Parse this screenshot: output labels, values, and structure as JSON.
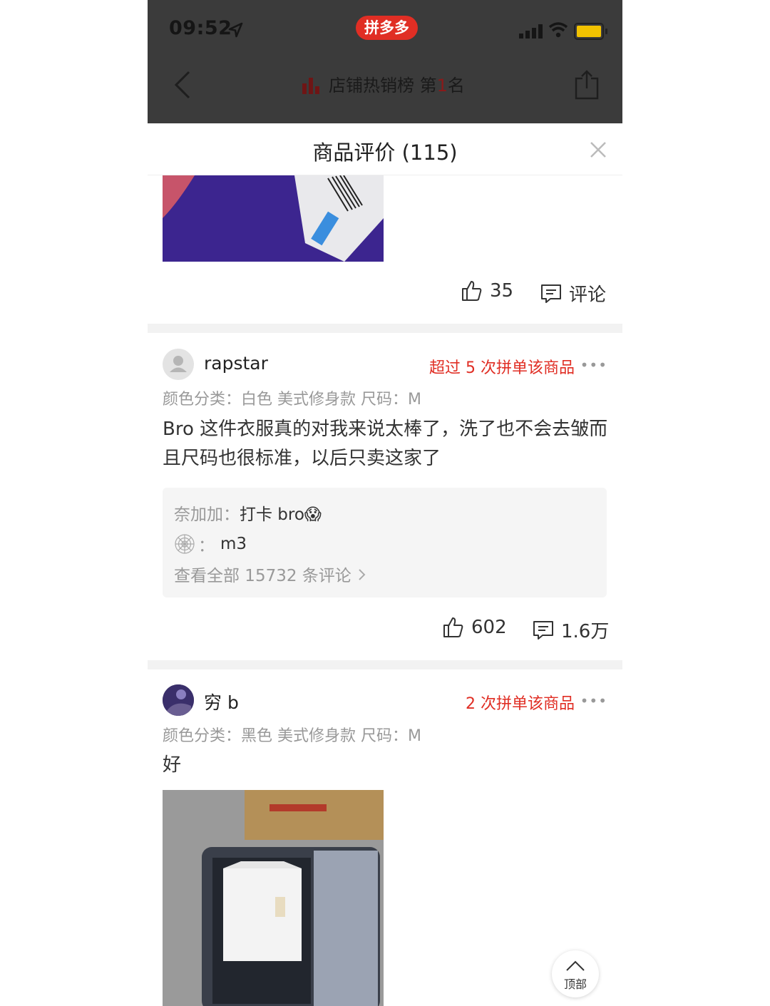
{
  "status_bar": {
    "time": "09:52",
    "app_brand": "拼多多"
  },
  "nav": {
    "rank_label": "店铺热销榜 第",
    "rank_number": "1",
    "rank_suffix": "名"
  },
  "sheet": {
    "title": "商品评价 (115)"
  },
  "review_prev": {
    "likes": "35",
    "comment_label": "评论"
  },
  "reviews": [
    {
      "username": "rapstar",
      "badge": "超过 5 次拼单该商品",
      "spec": "颜色分类：白色 美式修身款   尺码：M",
      "text": "Bro 这件衣服真的对我来说太棒了，洗了也不会去皱而且尺码也很标准，以后只卖这家了",
      "replies": [
        {
          "who": "奈加加：",
          "text": "打卡 bro😱"
        },
        {
          "who": "：",
          "text": "m3"
        }
      ],
      "view_all": "查看全部 15732 条评论",
      "likes": "602",
      "comments": "1.6万"
    },
    {
      "username": "穷 b",
      "badge": "2 次拼单该商品",
      "spec": "颜色分类：黑色 美式修身款   尺码：M",
      "text": "好"
    }
  ],
  "more_label": "•••",
  "top_button_label": "顶部",
  "colors": {
    "brand_red": "#e02e24",
    "header_dark": "#3b3b3b"
  }
}
